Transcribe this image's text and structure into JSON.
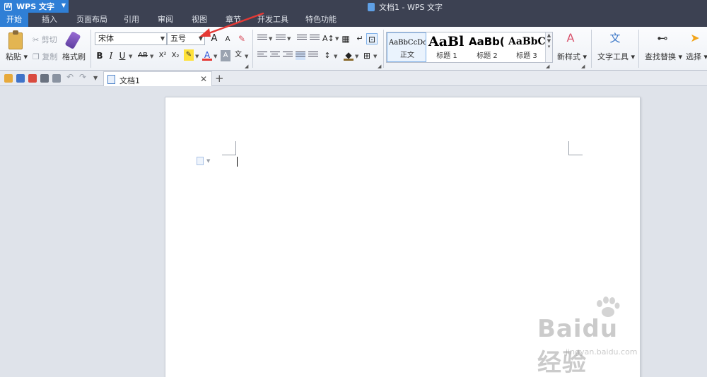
{
  "app": {
    "name": "WPS 文字",
    "window_title": "文档1 - WPS 文字"
  },
  "menu_tabs": [
    "开始",
    "插入",
    "页面布局",
    "引用",
    "审阅",
    "视图",
    "章节",
    "开发工具",
    "特色功能"
  ],
  "clipboard": {
    "paste": "粘贴",
    "cut": "剪切",
    "copy": "复制",
    "format_painter": "格式刷"
  },
  "font": {
    "family": "宋体",
    "size": "五号"
  },
  "format_buttons": {
    "bold": "B",
    "italic": "I",
    "underline": "U",
    "strikethrough": "AB",
    "superscript": "X²",
    "subscript": "X₂",
    "font_color": "A",
    "char_shading": "A",
    "phonetic": "文",
    "grow": "A",
    "shrink": "A"
  },
  "styles": [
    {
      "sample": "AaBbCcDd",
      "name": "正文"
    },
    {
      "sample": "AaBl",
      "name": "标题 1"
    },
    {
      "sample": "AaBb(",
      "name": "标题 2"
    },
    {
      "sample": "AaBbC",
      "name": "标题 3"
    }
  ],
  "big_buttons": {
    "new_style": "新样式",
    "text_tools": "文字工具",
    "find_replace": "查找替换",
    "select": "选择"
  },
  "document_tab": {
    "label": "文档1"
  },
  "new_tab_glyph": "+",
  "watermark": {
    "main": "Baidu经验",
    "sub": "jingyan.baidu.com"
  },
  "colors": {
    "accent": "#2f7fd6",
    "titlebar": "#3c4152",
    "annotation": "#e53935"
  }
}
